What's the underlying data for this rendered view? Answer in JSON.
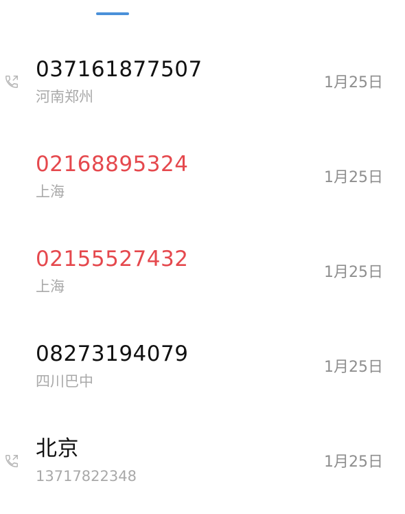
{
  "call_log": {
    "active_tab_indicator_color": "#4a90d9",
    "entries": [
      {
        "primary": "037161877507",
        "secondary": "河南郑州",
        "date": "1月25日",
        "missed": false,
        "has_call_icon": true,
        "icon": "phone-outgoing-icon"
      },
      {
        "primary": "02168895324",
        "secondary": "上海",
        "date": "1月25日",
        "missed": true,
        "has_call_icon": false
      },
      {
        "primary": "02155527432",
        "secondary": "上海",
        "date": "1月25日",
        "missed": true,
        "has_call_icon": false
      },
      {
        "primary": "08273194079",
        "secondary": "四川巴中",
        "date": "1月25日",
        "missed": false,
        "has_call_icon": false
      },
      {
        "primary": "北京",
        "secondary": "13717822348",
        "date": "1月25日",
        "missed": false,
        "has_call_icon": true,
        "icon": "phone-outgoing-icon"
      }
    ],
    "colors": {
      "missed": "#e5484d",
      "normal": "#111111",
      "secondary": "#a9a9a9",
      "date": "#8e8e8e"
    }
  }
}
